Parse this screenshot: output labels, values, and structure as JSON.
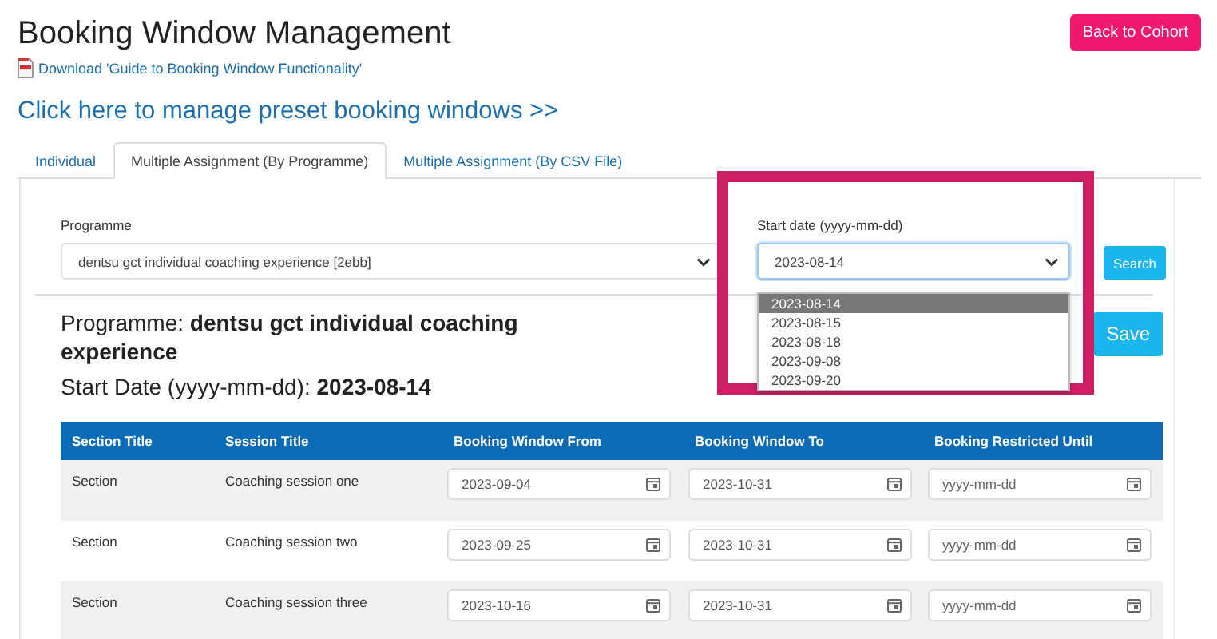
{
  "page": {
    "title": "Booking Window Management",
    "back_button": "Back to Cohort",
    "download_link": "Download 'Guide to Booking Window Functionality'",
    "preset_link": "Click here to manage preset booking windows >>"
  },
  "tabs": [
    {
      "label": "Individual",
      "selected": false
    },
    {
      "label": "Multiple Assignment (By Programme)",
      "selected": true
    },
    {
      "label": "Multiple Assignment (By CSV File)",
      "selected": false
    }
  ],
  "filters": {
    "programme": {
      "label": "Programme",
      "value": "dentsu gct individual coaching experience [2ebb]"
    },
    "start_date": {
      "label": "Start date (yyyy-mm-dd)",
      "value": "2023-08-14",
      "expanded": true,
      "options": [
        {
          "label": "2023-08-14",
          "selected": true
        },
        {
          "label": "2023-08-15",
          "selected": false
        },
        {
          "label": "2023-08-18",
          "selected": false
        },
        {
          "label": "2023-09-08",
          "selected": false
        },
        {
          "label": "2023-09-20",
          "selected": false
        }
      ]
    },
    "search_button": "Search"
  },
  "summary": {
    "programme": "Programme: **dentsu gct individual coaching experience**",
    "start_date": "Start Date (yyyy-mm-dd): **2023-08-14**",
    "save_button": "Save"
  },
  "table": {
    "columns": [
      "Section Title",
      "Session Title",
      "Booking Window From",
      "Booking Window To",
      "Booking Restricted Until"
    ],
    "rows": [
      {
        "section": "Section",
        "session": "Coaching session one",
        "from": {
          "value": "2023-09-04"
        },
        "to": {
          "value": "2023-10-31"
        },
        "until": {
          "placeholder": "yyyy-mm-dd"
        }
      },
      {
        "section": "Section",
        "session": "Coaching session two",
        "from": {
          "value": "2023-09-25"
        },
        "to": {
          "value": "2023-10-31"
        },
        "until": {
          "placeholder": "yyyy-mm-dd"
        }
      },
      {
        "section": "Section",
        "session": "Coaching session three",
        "from": {
          "value": "2023-10-16"
        },
        "to": {
          "value": "2023-10-31"
        },
        "until": {
          "placeholder": "yyyy-mm-dd"
        }
      }
    ]
  }
}
